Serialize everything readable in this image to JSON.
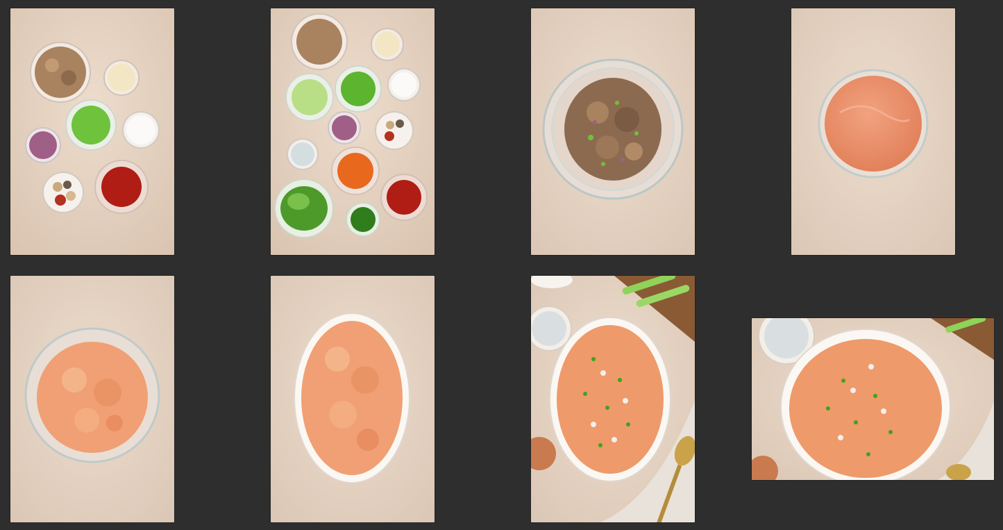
{
  "gallery": {
    "background": "#2e2e2e",
    "surface_color": "#e6d3c2",
    "photos": [
      {
        "subject": "ingredients-set-1"
      },
      {
        "subject": "ingredients-set-2"
      },
      {
        "subject": "chicken-mixture-bowl"
      },
      {
        "subject": "buffalo-sauce-bowl"
      },
      {
        "subject": "mixed-dip-bowl"
      },
      {
        "subject": "dip-in-baking-dish"
      },
      {
        "subject": "garnished-dip-vertical"
      },
      {
        "subject": "garnished-dip-horizontal"
      }
    ]
  }
}
